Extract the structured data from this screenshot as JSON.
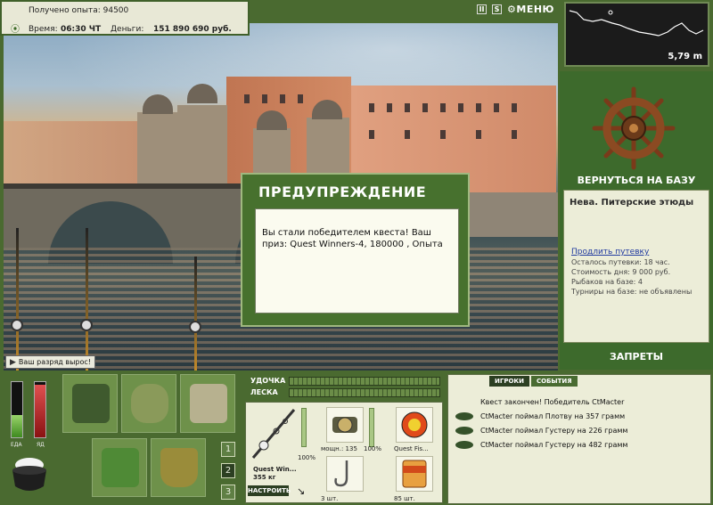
{
  "hud": {
    "exp_label": "Получено опыта:",
    "exp_value": "94500",
    "time_label": "Время:",
    "time_value": "06:30 ЧТ",
    "money_label": "Деньги:",
    "money_value": "151 890 690 руб.",
    "menu_label": "МЕНЮ",
    "pause_label": "II",
    "sound_label": "S"
  },
  "depth": {
    "value": "5,79 m"
  },
  "right_panel": {
    "return_label": "ВЕРНУТЬСЯ НА БАЗУ",
    "location_title": "Нева. Питерские этюды",
    "extend_link": "Продлить путевку",
    "lines": [
      "Осталось путевки: 18 час.",
      "Стоимость дня: 9 000 руб.",
      "Рыбаков на базе: 4",
      "Турниры на базе: не объявлены"
    ],
    "bans_label": "ЗАПРЕТЫ"
  },
  "dialog": {
    "title": "ПРЕДУПРЕЖДЕНИЕ",
    "message": "Вы стали победителем квеста! Ваш приз: Quest Winners-4, 180000 , Опыта"
  },
  "rank_tip": "Ваш разряд вырос!",
  "meters": {
    "food_label": "ЕДА",
    "poison_label": "ЯД",
    "food_level": 0.4,
    "poison_level": 0.95
  },
  "pages": [
    "1",
    "2",
    "3"
  ],
  "tackle": {
    "rod_label": "УДОЧКА",
    "line_label": "ЛЕСКА",
    "rod_name": "Quest Win...",
    "rod_weight": "355 кг",
    "rod_pct": "100%",
    "reel_caption": "мощн.: 135",
    "reel_pct": "100%",
    "lure_caption": "Quest Fis...",
    "hook_count": "3 шт.",
    "bait_count": "85 шт.",
    "setup_label": "НАСТРОИТЬ"
  },
  "events": {
    "tabs": [
      "ИГРОКИ",
      "СОБЫТИЯ"
    ],
    "header": "Квест закончен! Победитель CtMacter",
    "items": [
      "CtMacter поймал Плотву на 357 грамм",
      "CtMacter поймал Густеру на 226 грамм",
      "CtMacter поймал Густеру на 482 грамм"
    ]
  },
  "colors": {
    "panel_green": "#4a6a30",
    "dark_green": "#2c3f22",
    "cream": "#ecedd8"
  }
}
